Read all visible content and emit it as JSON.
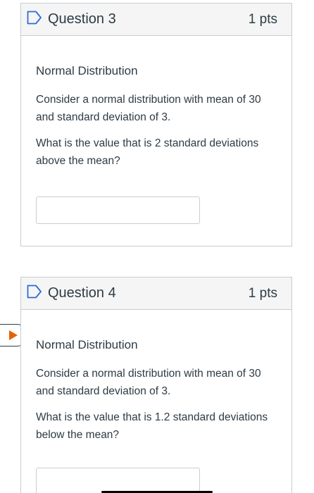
{
  "questions": [
    {
      "title": "Question 3",
      "points": "1 pts",
      "heading": "Normal Distribution",
      "paragraph1": "Consider a normal distribution with mean of 30 and standard deviation of 3.",
      "paragraph2": "What is the value that is 2 standard deviations above the mean?",
      "answer_value": ""
    },
    {
      "title": "Question 4",
      "points": "1 pts",
      "heading": "Normal Distribution",
      "paragraph1": "Consider a normal distribution with mean of 30 and standard deviation of 3.",
      "paragraph2": "What is the value that is 1.2 standard deviations below the mean?",
      "answer_value": ""
    }
  ],
  "icons": {
    "flag": "bookmark-flag-icon",
    "current_marker": "play-icon"
  },
  "colors": {
    "header_bg": "#f5f5f5",
    "border": "#c7cdd1",
    "text": "#2d3b45",
    "flag_outline": "#2d6bd6",
    "marker_arrow": "#e66000"
  }
}
